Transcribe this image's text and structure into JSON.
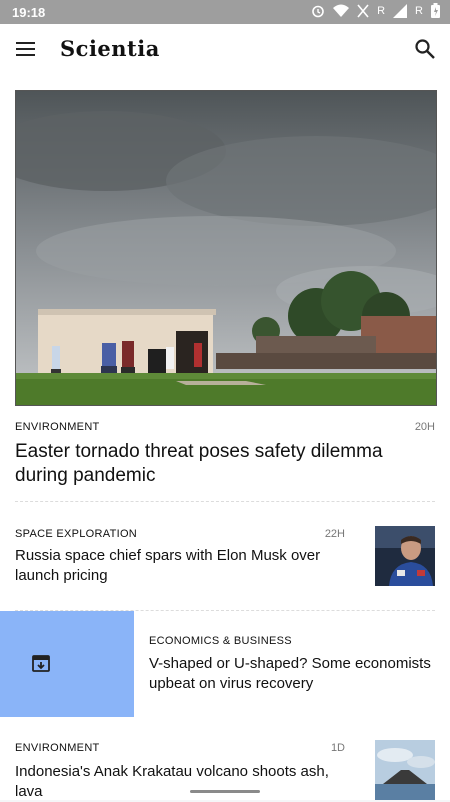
{
  "status_bar": {
    "time": "19:18",
    "roaming_label_1": "R",
    "roaming_label_2": "R",
    "icons": [
      "alarm-icon",
      "wifi-icon",
      "no-signal-icon",
      "signal-icon",
      "battery-icon"
    ]
  },
  "app_bar": {
    "title": "Scientia",
    "icons": [
      "menu-icon",
      "search-icon"
    ]
  },
  "feed": {
    "hero": {
      "category": "ENVIRONMENT",
      "age": "20H",
      "headline": "Easter tornado threat poses safety dilemma during pandemic"
    },
    "items": [
      {
        "category": "SPACE EXPLORATION",
        "age": "22H",
        "headline": "Russia space chief spars with Elon Musk over launch pricing"
      },
      {
        "category": "ECONOMICS & BUSINESS",
        "age": "",
        "headline": "V-shaped or U-shaped? Some economists upbeat on virus recovery"
      },
      {
        "category": "ENVIRONMENT",
        "age": "1D",
        "headline": "Indonesia's Anak Krakatau volcano shoots ash, lava"
      }
    ]
  },
  "colors": {
    "status_bar": "#9e9e9e",
    "swipe_action": "#8ab4f8",
    "background": "#f5f5f7"
  }
}
